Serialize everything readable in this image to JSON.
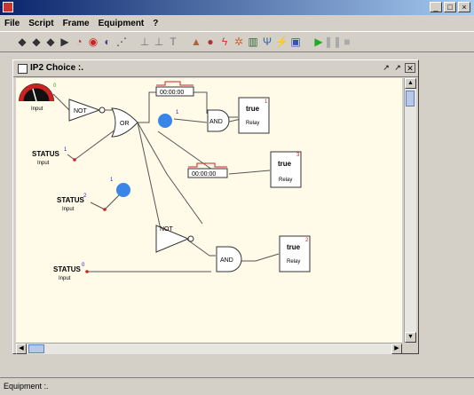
{
  "menu": [
    "File",
    "Script",
    "Frame",
    "Equipment",
    "?"
  ],
  "toolbar_icons": [
    "play-icon",
    "step-icon",
    "forward-icon",
    "next-icon",
    "timer-icon",
    "record-icon",
    "stop-icon",
    "dots-icon",
    "filter-icon",
    "filter2-icon",
    "text-icon",
    "lock-icon",
    "camera-icon",
    "lightning-icon",
    "network-icon",
    "chart-icon",
    "antenna-icon",
    "plug-icon",
    "monitor-icon",
    "run-icon",
    "pause-icon",
    "halt-icon"
  ],
  "window": {
    "title": "IP2 Choice :.",
    "controls": [
      "↗",
      "↗",
      "✕"
    ]
  },
  "diagram": {
    "input_top_label": "Input",
    "status_label": "STATUS",
    "input_label": "Input",
    "status_numbers": [
      "1",
      "2",
      "0"
    ],
    "not_label": "NOT",
    "or_label": "OR",
    "and_label": "AND",
    "timer_text": "00:00:00",
    "relay_value": "true",
    "relay_label": "Relay",
    "relay_numbers": [
      "1",
      "3",
      "2"
    ],
    "led_numbers": [
      "1",
      "1"
    ],
    "gauge_number": "0"
  },
  "status": {
    "text": "Equipment :."
  }
}
